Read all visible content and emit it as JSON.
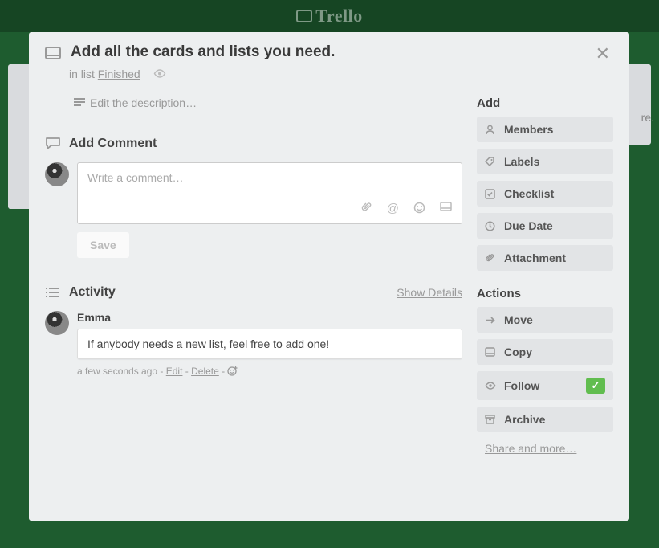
{
  "brand": "Trello",
  "bg_hint": "re.",
  "card": {
    "title": "Add all the cards and lists you need.",
    "list_prefix": "in list ",
    "list_name": "Finished",
    "edit_description": "Edit the description…"
  },
  "comment": {
    "heading": "Add Comment",
    "placeholder": "Write a comment…",
    "save": "Save"
  },
  "activity": {
    "heading": "Activity",
    "show_details": "Show Details",
    "items": [
      {
        "author": "Emma",
        "text": "If anybody needs a new list, feel free to add one!",
        "time": "a few seconds ago",
        "edit": "Edit",
        "delete": "Delete"
      }
    ]
  },
  "sidebar": {
    "add_heading": "Add",
    "add": {
      "members": "Members",
      "labels": "Labels",
      "checklist": "Checklist",
      "due_date": "Due Date",
      "attachment": "Attachment"
    },
    "actions_heading": "Actions",
    "actions": {
      "move": "Move",
      "copy": "Copy",
      "follow": "Follow",
      "archive": "Archive"
    },
    "share": "Share and more…"
  }
}
